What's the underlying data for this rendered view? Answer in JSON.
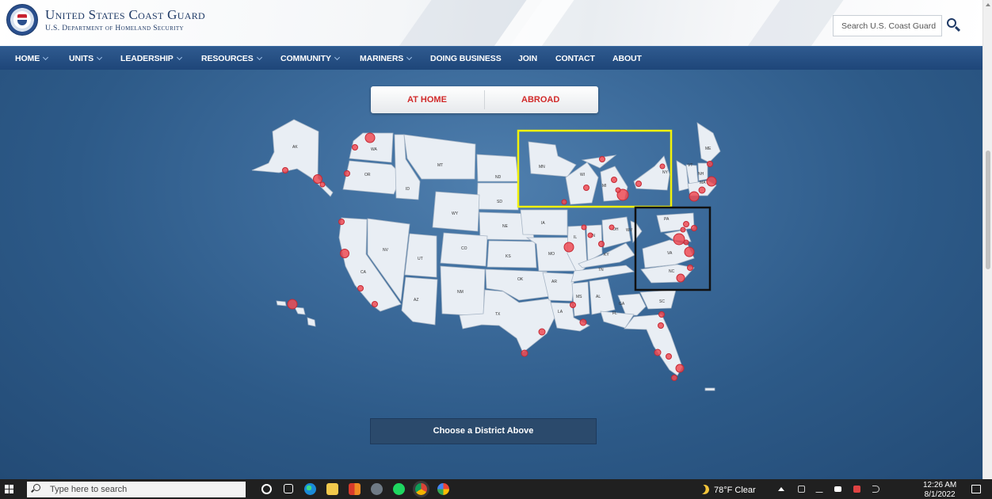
{
  "header": {
    "title": "United States Coast Guard",
    "subtitle": "U.S. Department of Homeland Security",
    "search_placeholder": "Search U.S. Coast Guard"
  },
  "nav": {
    "items": [
      {
        "label": "HOME",
        "has_menu": true
      },
      {
        "label": "UNITS",
        "has_menu": true
      },
      {
        "label": "LEADERSHIP",
        "has_menu": true
      },
      {
        "label": "RESOURCES",
        "has_menu": true
      },
      {
        "label": "COMMUNITY",
        "has_menu": true
      },
      {
        "label": "MARINERS",
        "has_menu": true
      },
      {
        "label": "DOING BUSINESS",
        "has_menu": false
      },
      {
        "label": "JOIN",
        "has_menu": false
      },
      {
        "label": "CONTACT",
        "has_menu": false
      },
      {
        "label": "ABOUT",
        "has_menu": false
      }
    ]
  },
  "tabs": {
    "home": "AT HOME",
    "abroad": "ABROAD"
  },
  "map": {
    "state_labels": [
      "AK",
      "WA",
      "OR",
      "MT",
      "ID",
      "ND",
      "SD",
      "MN",
      "WY",
      "NE",
      "IA",
      "WI",
      "MI",
      "NY",
      "ME",
      "VT",
      "NH",
      "MA",
      "PA",
      "OH",
      "IN",
      "IL",
      "NV",
      "UT",
      "CO",
      "KS",
      "MO",
      "KY",
      "WV",
      "VA",
      "NC",
      "CA",
      "AZ",
      "NM",
      "OK",
      "AR",
      "TN",
      "MS",
      "AL",
      "GA",
      "SC",
      "FL",
      "TX",
      "LA"
    ],
    "highlight_colors": {
      "great_lakes": "#f2f20a",
      "mid_atlantic": "#111111"
    }
  },
  "choose_button": "Choose a District Above",
  "taskbar": {
    "search_placeholder": "Type here to search",
    "weather": "78°F  Clear",
    "time": "12:26 AM",
    "date": "8/1/2022"
  },
  "colors": {
    "brand_navy": "#1f3a66",
    "tab_red": "#d12a2a",
    "marker_red": "#ef4c55"
  }
}
